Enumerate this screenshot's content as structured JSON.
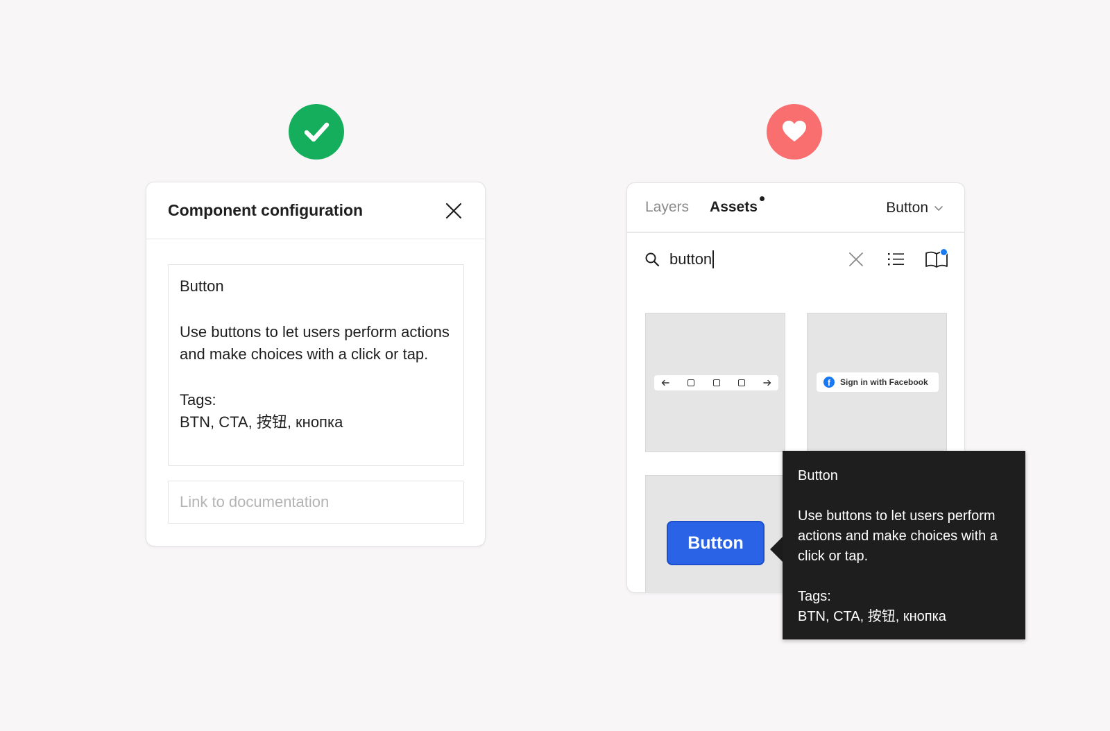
{
  "badges": {
    "left": {
      "icon": "check-icon",
      "color": "#14ae5c"
    },
    "right": {
      "icon": "heart-icon",
      "color": "#f96e6e"
    }
  },
  "config": {
    "title": "Component configuration",
    "description": {
      "name": "Button",
      "body": "Use buttons to let users perform actions and make choices with a click or tap.",
      "tags_label": "Tags:",
      "tags": "BTN, CTA, 按钮, кнопка"
    },
    "doc_link_placeholder": "Link to documentation"
  },
  "assets": {
    "tabs": [
      {
        "label": "Layers",
        "active": false
      },
      {
        "label": "Assets",
        "active": true,
        "has_notification": true
      }
    ],
    "library_select": "Button",
    "search_value": "button",
    "thumbnails": [
      {
        "preview": "pagination-buttons"
      },
      {
        "preview": "Sign in with Facebook"
      },
      {
        "preview": "Button"
      }
    ]
  },
  "tooltip": {
    "name": "Button",
    "body": "Use buttons to let users perform actions and make choices with a click or tap.",
    "tags_label": "Tags:",
    "tags": "BTN, CTA, 按钮, кнопка"
  },
  "colors": {
    "background": "#f8f6f7",
    "accent_blue": "#2b63e6",
    "tooltip_bg": "#1e1e1e"
  }
}
